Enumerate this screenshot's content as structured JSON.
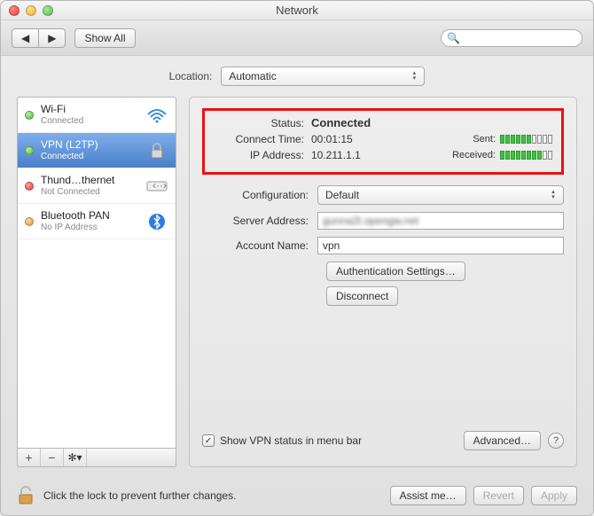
{
  "window": {
    "title": "Network"
  },
  "toolbar": {
    "show_all": "Show All"
  },
  "location": {
    "label": "Location:",
    "value": "Automatic"
  },
  "sidebar": {
    "items": [
      {
        "name": "Wi-Fi",
        "sub": "Connected",
        "status": "green",
        "icon": "wifi"
      },
      {
        "name": "VPN (L2TP)",
        "sub": "Connected",
        "status": "green",
        "icon": "lock"
      },
      {
        "name": "Thund…thernet",
        "sub": "Not Connected",
        "status": "red",
        "icon": "ethernet"
      },
      {
        "name": "Bluetooth PAN",
        "sub": "No IP Address",
        "status": "orange",
        "icon": "bluetooth"
      }
    ]
  },
  "status": {
    "status_label": "Status:",
    "status_value": "Connected",
    "time_label": "Connect Time:",
    "time_value": "00:01:15",
    "ip_label": "IP Address:",
    "ip_value": "10.211.1.1",
    "sent_label": "Sent:",
    "sent_bars": 6,
    "sent_total": 10,
    "recv_label": "Received:",
    "recv_bars": 8,
    "recv_total": 10
  },
  "form": {
    "config_label": "Configuration:",
    "config_value": "Default",
    "server_label": "Server Address:",
    "server_value": "gunna2t.opengw.net",
    "account_label": "Account Name:",
    "account_value": "vpn",
    "auth_btn": "Authentication Settings…",
    "disconnect_btn": "Disconnect",
    "show_status_chk": "Show VPN status in menu bar",
    "advanced_btn": "Advanced…"
  },
  "footer": {
    "lock_text": "Click the lock to prevent further changes.",
    "assist": "Assist me…",
    "revert": "Revert",
    "apply": "Apply"
  }
}
